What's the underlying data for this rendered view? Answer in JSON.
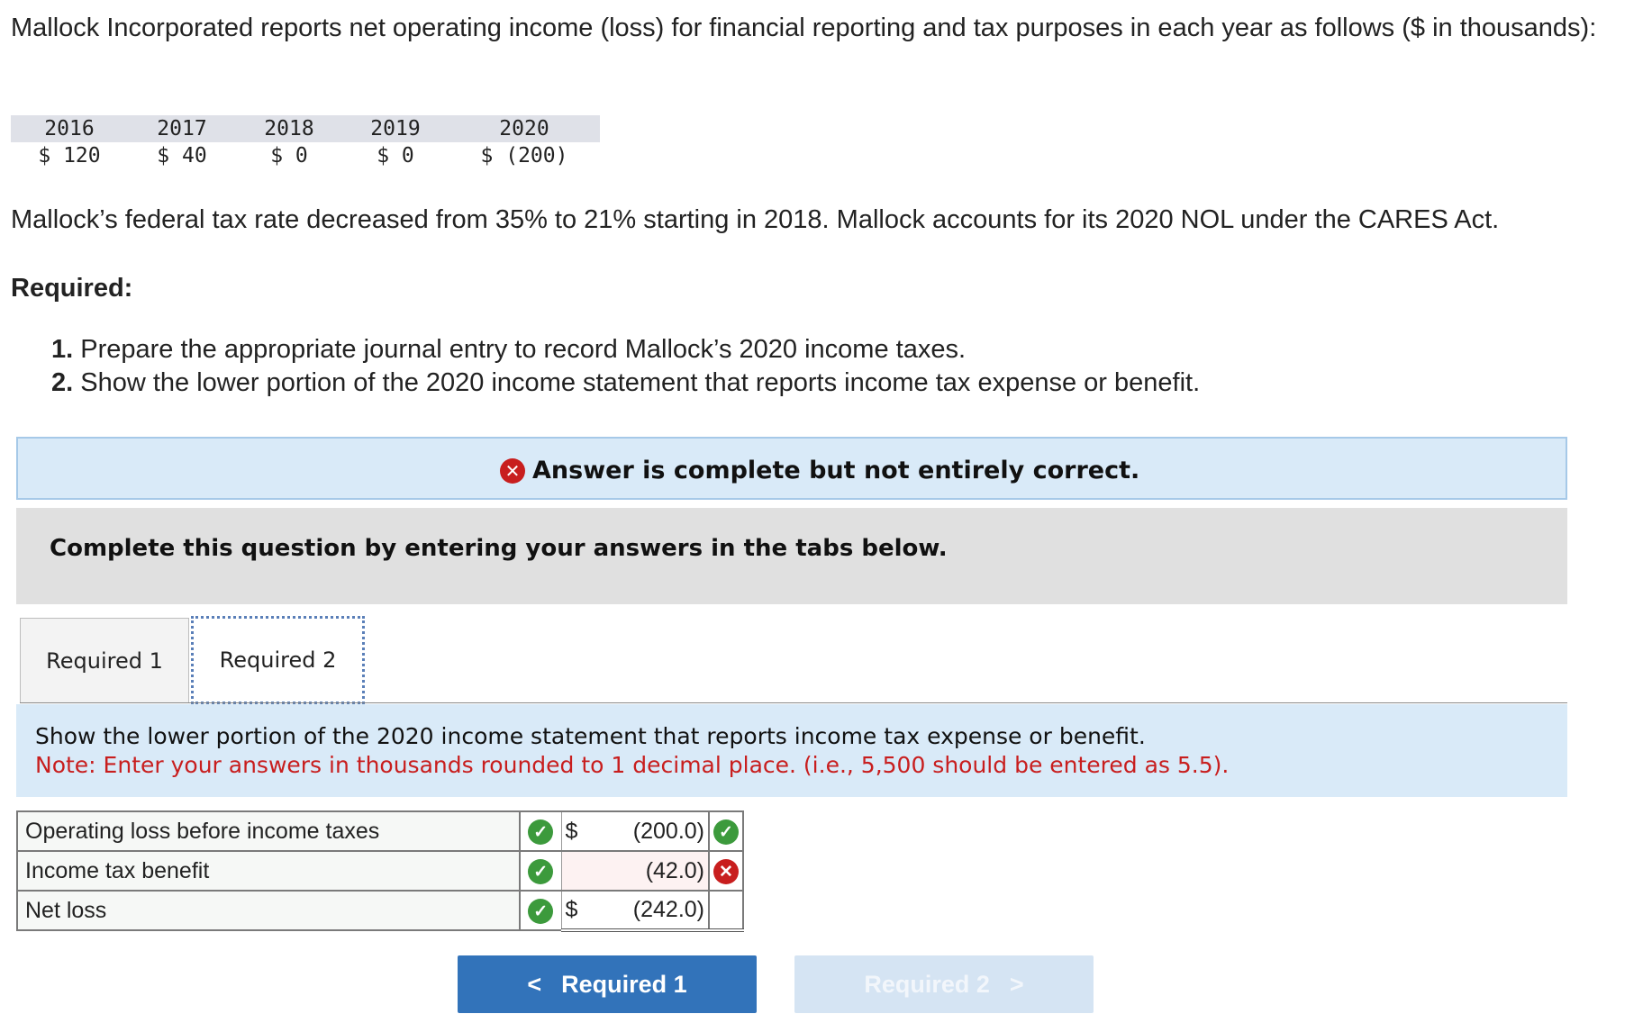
{
  "problem": {
    "intro": "Mallock Incorporated reports net operating income (loss) for financial reporting and tax purposes in each year as follows ($ in thousands):",
    "years": [
      "2016",
      "2017",
      "2018",
      "2019",
      "2020"
    ],
    "amounts": [
      "$ 120",
      "$ 40",
      "$ 0",
      "$ 0",
      "$ (200)"
    ],
    "rate_text": "Mallock’s federal tax rate decreased from 35% to 21% starting in 2018. Mallock accounts for its 2020 NOL under the CARES Act.",
    "required_heading": "Required:",
    "req1_num": "1.",
    "req1_text": "Prepare the appropriate journal entry to record Mallock’s 2020 income taxes.",
    "req2_num": "2.",
    "req2_text": "Show the lower portion of the 2020 income statement that reports income tax expense or benefit."
  },
  "banner": {
    "message": "Answer is complete but not entirely correct."
  },
  "instructions": {
    "text": "Complete this question by entering your answers in the tabs below."
  },
  "tabs": [
    {
      "label": "Required 1"
    },
    {
      "label": "Required 2"
    }
  ],
  "panel": {
    "prompt": "Show the lower portion of the 2020 income statement that reports income tax expense or benefit.",
    "note": "Note: Enter your answers in thousands rounded to 1 decimal place. (i.e., 5,500 should be entered as 5.5)."
  },
  "answer_rows": [
    {
      "label": "Operating loss before income taxes",
      "currency": "$",
      "value": "(200.0)",
      "value_status": "correct"
    },
    {
      "label": "Income tax benefit",
      "currency": "",
      "value": "(42.0)",
      "value_status": "incorrect"
    },
    {
      "label": "Net loss",
      "currency": "$",
      "value": "(242.0)",
      "value_status": ""
    }
  ],
  "nav": {
    "prev_label": "Required 1",
    "next_label": "Required 2"
  }
}
